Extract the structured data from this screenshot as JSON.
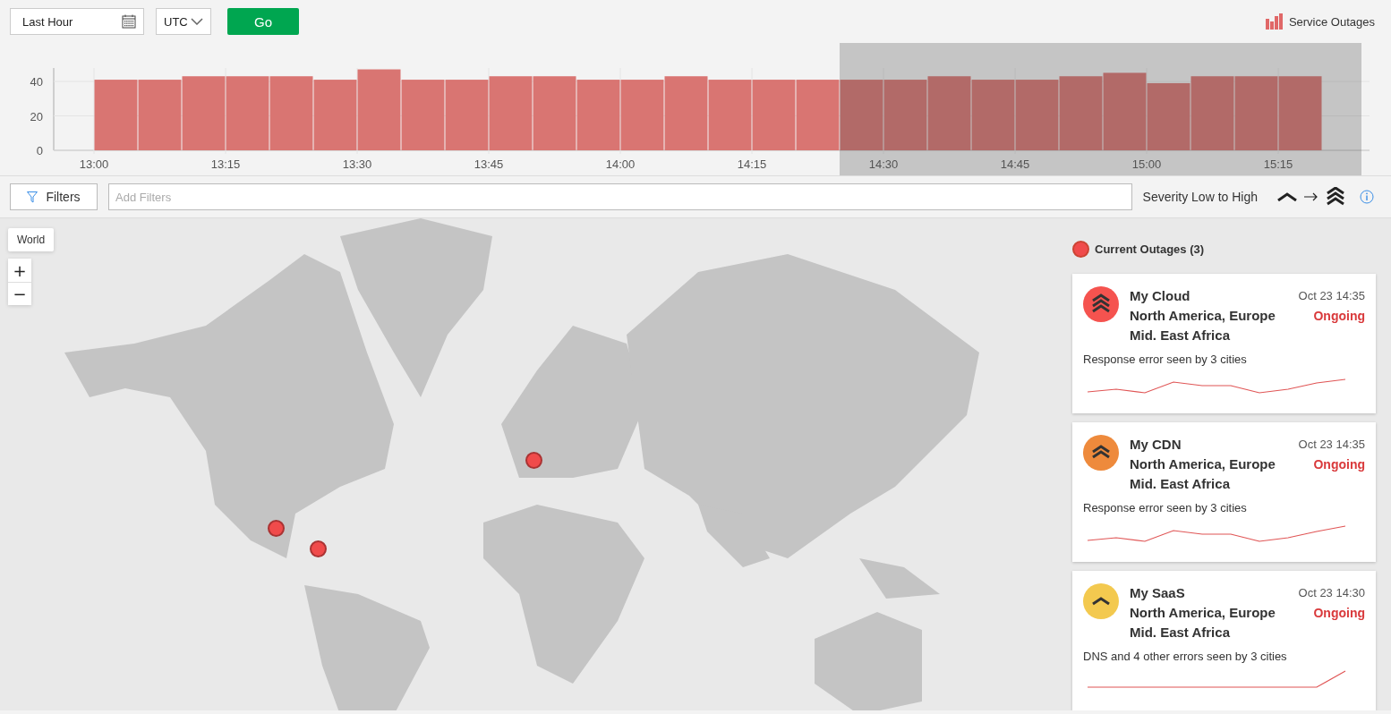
{
  "toolbar": {
    "range": {
      "value": "Last Hour"
    },
    "timezone": {
      "value": "UTC"
    },
    "go_button": "Go",
    "view_link": "Service Outages"
  },
  "histogram": {
    "chart_data": {
      "type": "bar",
      "categories": [
        "13:00",
        null,
        null,
        "13:15",
        null,
        null,
        "13:30",
        null,
        null,
        "13:45",
        null,
        null,
        "14:00",
        null,
        null,
        "14:15",
        null,
        null,
        "14:30",
        null,
        null,
        "14:45",
        null,
        null,
        "15:00",
        null,
        null,
        "15:15"
      ],
      "values": [
        41,
        41,
        43,
        43,
        43,
        41,
        47,
        41,
        41,
        43,
        43,
        41,
        41,
        43,
        41,
        41,
        41,
        41,
        41,
        43,
        41,
        41,
        43,
        45,
        39,
        43,
        43,
        43
      ],
      "yticks": [
        0,
        20,
        40
      ],
      "ylim": [
        0,
        48
      ],
      "grid": true
    },
    "selection": {
      "on": true
    }
  },
  "filters": {
    "button": "Filters",
    "field": {
      "placeholder": "Add Filters"
    },
    "legend": "Severity Low to High"
  },
  "map": {
    "region_button": "World",
    "zoom_in": "+",
    "zoom_out": "−"
  },
  "outages": {
    "title": "Current Outages (3)",
    "cards": [
      {
        "service": "My Cloud",
        "regions": "North America, Europe",
        "regions_2": "Mid. East Africa",
        "time": "Oct 23 14:35",
        "status": "Ongoing",
        "summary": "Response error seen by 3 cities",
        "kind": "high",
        "color": "#f5534f"
      },
      {
        "service": "My CDN",
        "regions": "North America, Europe",
        "regions_2": "Mid. East Africa",
        "time": "Oct 23 14:35",
        "status": "Ongoing",
        "summary": "Response error seen by 3 cities",
        "kind": "medium",
        "color": "#ee8a3c"
      },
      {
        "service": "My SaaS",
        "regions": "North America, Europe",
        "regions_2": "Mid. East Africa",
        "time": "Oct 23 14:30",
        "status": "Ongoing",
        "summary": "DNS and 4 other errors seen by 3 cities",
        "kind": "low",
        "color": "#f3c94f"
      }
    ]
  }
}
